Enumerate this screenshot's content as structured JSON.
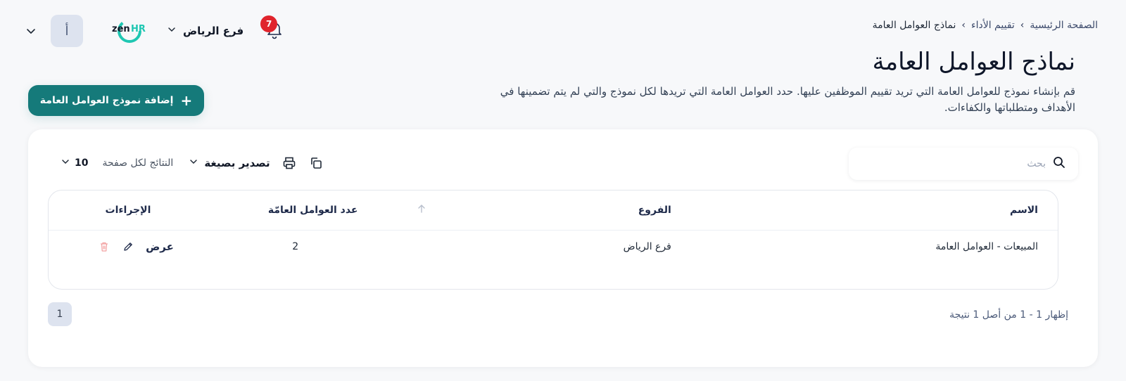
{
  "breadcrumb": {
    "home": "الصفحة الرئيسية",
    "section": "تقييم الأداء",
    "current": "نماذج العوامل العامة"
  },
  "topbar": {
    "avatar_initial": "أ",
    "logo_text": "zenHR",
    "branch": "فرع الرياض",
    "notifications_count": "7"
  },
  "header": {
    "title": "نماذج العوامل العامة",
    "description": "قم بإنشاء نموذج للعوامل العامة التي تريد تقييم الموظفين عليها. حدد العوامل العامة التي تريدها لكل نموذج والتي لم يتم تضمينها في الأهداف ومتطلباتها والكفاءات.",
    "add_button_label": "إضافة نموذج العوامل العامة"
  },
  "search": {
    "placeholder": "بحث"
  },
  "toolbar": {
    "export_label": "تصدير بصيغة",
    "per_page_label": "النتائج لكل صفحة",
    "per_page_value": "10"
  },
  "table": {
    "columns": {
      "name": "الاسم",
      "branches": "الفروع",
      "count": "عدد العوامل العامّة",
      "actions": "الإجراءات"
    },
    "rows": [
      {
        "name": "المبيعات - العوامل العامة",
        "branch": "فرع الرياض",
        "count": "2",
        "view_label": "عرض"
      }
    ]
  },
  "pagination": {
    "info": "إظهار 1 - 1 من أصل 1 نتيجة",
    "current_page": "1"
  },
  "colors": {
    "primary": "#157a7a",
    "badge": "#e0242c",
    "delete_icon": "#f2a0a0",
    "logo_accent": "#1fc7b2"
  }
}
